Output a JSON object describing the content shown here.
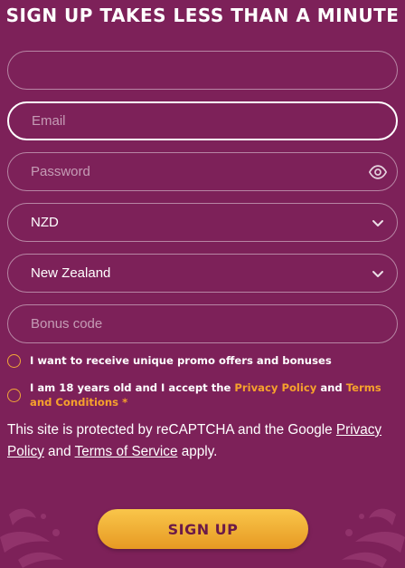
{
  "header": {
    "title": "Sign up takes less than a minute"
  },
  "form": {
    "first_field": {
      "value": ""
    },
    "email": {
      "placeholder": "Email"
    },
    "password": {
      "placeholder": "Password"
    },
    "currency": {
      "selected": "NZD"
    },
    "country": {
      "selected": "New Zealand"
    },
    "bonus_code": {
      "placeholder": "Bonus code"
    },
    "promo_consent": {
      "label": "I want to receive unique promo offers and bonuses"
    },
    "age_consent": {
      "text_before": "I am 18 years old and I accept the ",
      "privacy_link": "Privacy Policy",
      "text_middle": " and ",
      "terms_link": "Terms and Conditions *"
    }
  },
  "recaptcha": {
    "text_before": "This site is protected by reCAPTCHA and the Google ",
    "privacy_link": "Privacy Policy",
    "text_middle": " and ",
    "terms_link": "Terms of Service",
    "text_after": " apply."
  },
  "actions": {
    "signup_label": "SIGN UP"
  },
  "colors": {
    "background": "#7d2159",
    "accent": "#f6a12c",
    "button_text": "#6b1a48"
  },
  "icons": [
    "eye-icon",
    "chevron-down-icon",
    "decorative-flourish-icon"
  ]
}
